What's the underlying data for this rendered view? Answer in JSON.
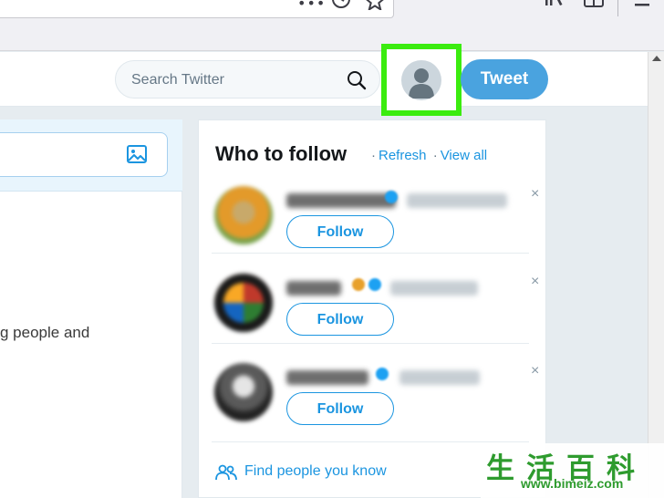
{
  "browser": {
    "icons": [
      "more-icon",
      "clock-icon",
      "star-icon",
      "library-icon",
      "sidebar-icon",
      "menu-icon"
    ]
  },
  "twitter_header": {
    "search_placeholder": "Search Twitter",
    "tweet_label": "Tweet",
    "highlight_color": "#3bec0f",
    "accent_color": "#1da1f2"
  },
  "left_column": {
    "text": "g people and"
  },
  "who_to_follow": {
    "title": "Who to follow",
    "separator": "·",
    "refresh_label": "Refresh",
    "view_all_label": "View all",
    "suggestions": [
      {
        "follow_label": "Follow",
        "dismiss": "×"
      },
      {
        "follow_label": "Follow",
        "dismiss": "×"
      },
      {
        "follow_label": "Follow",
        "dismiss": "×"
      }
    ],
    "find_people_label": "Find people you know"
  },
  "watermark": {
    "chars": "生活百科",
    "url": "www.bimeiz.com"
  }
}
